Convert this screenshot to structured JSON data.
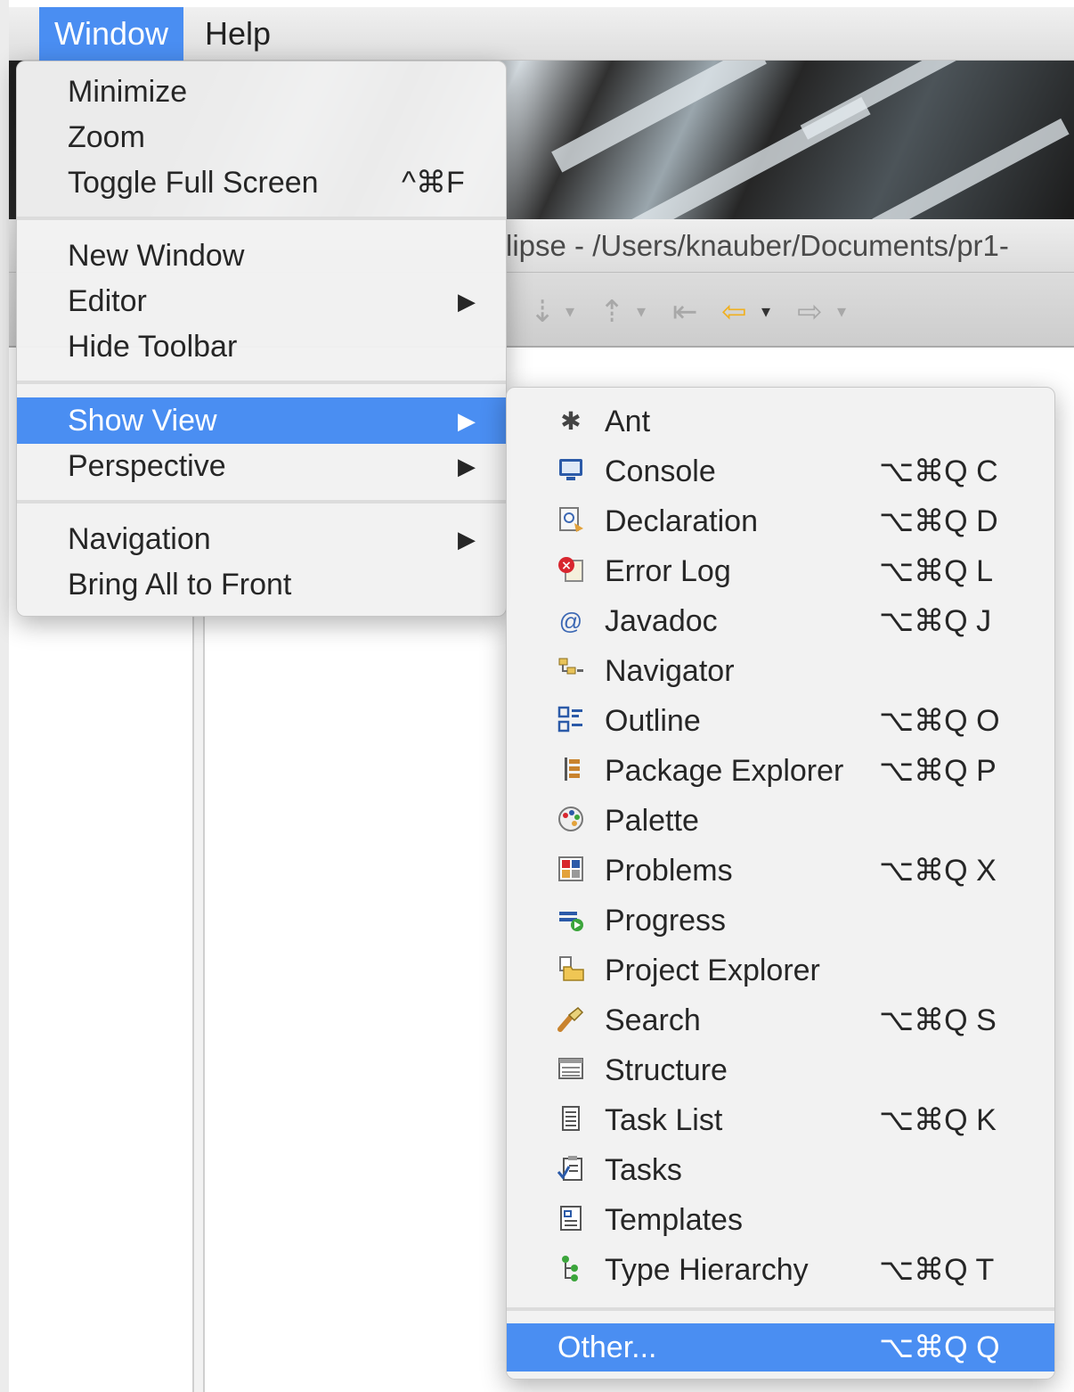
{
  "menubar": {
    "items": [
      {
        "label": "Window",
        "active": true
      },
      {
        "label": "Help",
        "active": false
      }
    ]
  },
  "window_title_partial": "lipse - /Users/knauber/Documents/pr1-",
  "window_menu": {
    "groups": [
      [
        {
          "label": "Minimize",
          "shortcut": "",
          "submenu": false
        },
        {
          "label": "Zoom",
          "shortcut": "",
          "submenu": false
        },
        {
          "label": "Toggle Full Screen",
          "shortcut": "^⌘F",
          "submenu": false
        }
      ],
      [
        {
          "label": "New Window",
          "shortcut": "",
          "submenu": false
        },
        {
          "label": "Editor",
          "shortcut": "",
          "submenu": true
        },
        {
          "label": "Hide Toolbar",
          "shortcut": "",
          "submenu": false
        }
      ],
      [
        {
          "label": "Show View",
          "shortcut": "",
          "submenu": true,
          "selected": true
        },
        {
          "label": "Perspective",
          "shortcut": "",
          "submenu": true
        }
      ],
      [
        {
          "label": "Navigation",
          "shortcut": "",
          "submenu": true
        },
        {
          "label": "Bring All to Front",
          "shortcut": "",
          "submenu": false
        }
      ]
    ]
  },
  "show_view_menu": {
    "items": [
      {
        "label": "Ant",
        "shortcut": "",
        "icon": "ant-icon"
      },
      {
        "label": "Console",
        "shortcut": "⌥⌘Q C",
        "icon": "console-icon"
      },
      {
        "label": "Declaration",
        "shortcut": "⌥⌘Q D",
        "icon": "declaration-icon"
      },
      {
        "label": "Error Log",
        "shortcut": "⌥⌘Q L",
        "icon": "error-log-icon"
      },
      {
        "label": "Javadoc",
        "shortcut": "⌥⌘Q J",
        "icon": "javadoc-icon"
      },
      {
        "label": "Navigator",
        "shortcut": "",
        "icon": "navigator-icon"
      },
      {
        "label": "Outline",
        "shortcut": "⌥⌘Q O",
        "icon": "outline-icon"
      },
      {
        "label": "Package Explorer",
        "shortcut": "⌥⌘Q P",
        "icon": "package-explorer-icon"
      },
      {
        "label": "Palette",
        "shortcut": "",
        "icon": "palette-icon"
      },
      {
        "label": "Problems",
        "shortcut": "⌥⌘Q X",
        "icon": "problems-icon"
      },
      {
        "label": "Progress",
        "shortcut": "",
        "icon": "progress-icon"
      },
      {
        "label": "Project Explorer",
        "shortcut": "",
        "icon": "project-explorer-icon"
      },
      {
        "label": "Search",
        "shortcut": "⌥⌘Q S",
        "icon": "search-icon"
      },
      {
        "label": "Structure",
        "shortcut": "",
        "icon": "structure-icon"
      },
      {
        "label": "Task List",
        "shortcut": "⌥⌘Q K",
        "icon": "task-list-icon"
      },
      {
        "label": "Tasks",
        "shortcut": "",
        "icon": "tasks-icon"
      },
      {
        "label": "Templates",
        "shortcut": "",
        "icon": "templates-icon"
      },
      {
        "label": "Type Hierarchy",
        "shortcut": "⌥⌘Q T",
        "icon": "type-hierarchy-icon"
      }
    ],
    "other": {
      "label": "Other...",
      "shortcut": "⌥⌘Q Q"
    }
  },
  "colors": {
    "selection": "#4a8ef2",
    "menu_background": "#f2f2f2",
    "menu_text": "#262626",
    "toolbar_back_arrow": "#f0b020"
  }
}
